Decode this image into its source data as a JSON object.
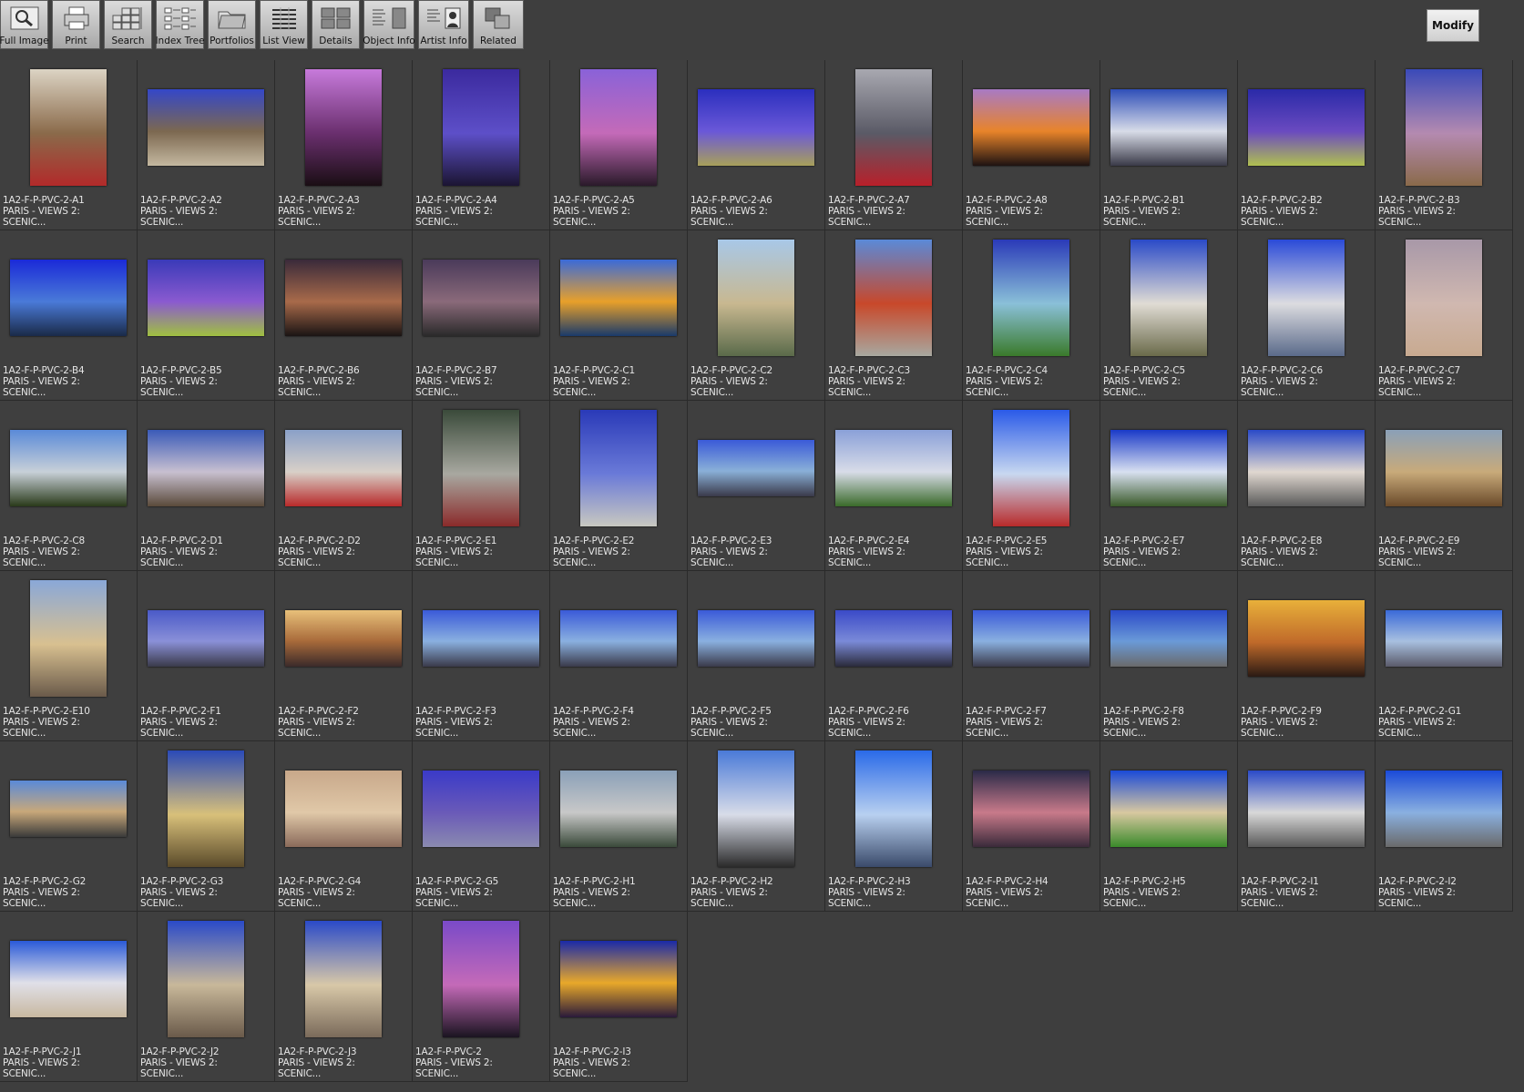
{
  "toolbar": {
    "buttons": [
      {
        "id": "full-image",
        "label": "Full Image",
        "icon": "magnifier-icon"
      },
      {
        "id": "print",
        "label": "Print",
        "icon": "printer-icon"
      },
      {
        "id": "search",
        "label": "Search",
        "icon": "search-icon"
      },
      {
        "id": "index-tree",
        "label": "Index Tree",
        "icon": "tree-icon"
      },
      {
        "id": "portfolios",
        "label": "Portfolios",
        "icon": "folder-icon"
      },
      {
        "id": "list-view",
        "label": "List View",
        "icon": "list-icon"
      },
      {
        "id": "details",
        "label": "Details",
        "icon": "details-icon"
      },
      {
        "id": "object-info",
        "label": "Object Info",
        "icon": "object-info-icon"
      },
      {
        "id": "artist-info",
        "label": "Artist  Info",
        "icon": "artist-info-icon"
      },
      {
        "id": "related",
        "label": "Related",
        "icon": "related-icon"
      }
    ],
    "modify_label": "Modify"
  },
  "caption_line2": "PARIS - VIEWS 2:",
  "caption_line3": "SCENIC...",
  "thumbnails": [
    {
      "code": "1A2-F-P-PVC-2-A1",
      "o": "p",
      "c": [
        "#dcd4c4",
        "#8a6a4a",
        "#b22a2a"
      ]
    },
    {
      "code": "1A2-F-P-PVC-2-A2",
      "o": "l",
      "c": [
        "#3447c8",
        "#7c6850",
        "#c4b8a0"
      ]
    },
    {
      "code": "1A2-F-P-PVC-2-A3",
      "o": "p",
      "c": [
        "#c77adb",
        "#6a2f6e",
        "#1a0e14"
      ]
    },
    {
      "code": "1A2-F-P-PVC-2-A4",
      "o": "p",
      "c": [
        "#3b2a9e",
        "#5d4fc8",
        "#1b1532"
      ]
    },
    {
      "code": "1A2-F-P-PVC-2-A5",
      "o": "p",
      "c": [
        "#8a62d8",
        "#c46ab8",
        "#2a1a2a"
      ]
    },
    {
      "code": "1A2-F-P-PVC-2-A6",
      "o": "l",
      "c": [
        "#2b2fbe",
        "#6a58d8",
        "#a8a05a"
      ]
    },
    {
      "code": "1A2-F-P-PVC-2-A7",
      "o": "p",
      "c": [
        "#a8a8b0",
        "#5a5a66",
        "#b8202a"
      ]
    },
    {
      "code": "1A2-F-P-PVC-2-A8",
      "o": "l",
      "c": [
        "#a87ac4",
        "#e8842a",
        "#1e1212"
      ]
    },
    {
      "code": "1A2-F-P-PVC-2-B1",
      "o": "l",
      "c": [
        "#2f4fb8",
        "#d8dce8",
        "#3a3a48"
      ]
    },
    {
      "code": "1A2-F-P-PVC-2-B2",
      "o": "l",
      "c": [
        "#2a2aa8",
        "#6a4ac0",
        "#b0c050"
      ]
    },
    {
      "code": "1A2-F-P-PVC-2-B3",
      "o": "p",
      "c": [
        "#3a4ab8",
        "#b48ab0",
        "#8a6a4a"
      ]
    },
    {
      "code": "1A2-F-P-PVC-2-B4",
      "o": "l",
      "c": [
        "#1a2ad8",
        "#4a7ad8",
        "#1a2a48"
      ]
    },
    {
      "code": "1A2-F-P-PVC-2-B5",
      "o": "l",
      "c": [
        "#3a3ab8",
        "#8a5ad0",
        "#a0c040"
      ]
    },
    {
      "code": "1A2-F-P-PVC-2-B6",
      "o": "l",
      "c": [
        "#3a2a3a",
        "#a86a4a",
        "#1a1414"
      ]
    },
    {
      "code": "1A2-F-P-PVC-2-B7",
      "o": "l",
      "c": [
        "#4a3a5a",
        "#8a6a7a",
        "#2a2a2a"
      ]
    },
    {
      "code": "1A2-F-P-PVC-2-C1",
      "o": "l",
      "c": [
        "#3a6ad8",
        "#e8a02a",
        "#1a3a6a"
      ]
    },
    {
      "code": "1A2-F-P-PVC-2-C2",
      "o": "p",
      "c": [
        "#a8c8e8",
        "#c8b890",
        "#5a6a4a"
      ]
    },
    {
      "code": "1A2-F-P-PVC-2-C3",
      "o": "p",
      "c": [
        "#5a8ad8",
        "#c8482a",
        "#a8a8a0"
      ]
    },
    {
      "code": "1A2-F-P-PVC-2-C4",
      "o": "p",
      "c": [
        "#2a3ab8",
        "#8ac0d8",
        "#3a7a2a"
      ]
    },
    {
      "code": "1A2-F-P-PVC-2-C5",
      "o": "p",
      "c": [
        "#2a4ac8",
        "#e0dcd4",
        "#6a6a4a"
      ]
    },
    {
      "code": "1A2-F-P-PVC-2-C6",
      "o": "p",
      "c": [
        "#2a4ad8",
        "#dcdce0",
        "#5a6a8a"
      ]
    },
    {
      "code": "1A2-F-P-PVC-2-C7",
      "o": "p",
      "c": [
        "#a898a8",
        "#d0b8b0",
        "#c8aa90"
      ]
    },
    {
      "code": "1A2-F-P-PVC-2-C8",
      "o": "l",
      "c": [
        "#5a8ad8",
        "#c8d0d8",
        "#2a3a1a"
      ]
    },
    {
      "code": "1A2-F-P-PVC-2-D1",
      "o": "l",
      "c": [
        "#3a5ab8",
        "#c8c0d0",
        "#5a4a3a"
      ]
    },
    {
      "code": "1A2-F-P-PVC-2-D2",
      "o": "l",
      "c": [
        "#8aa0c8",
        "#d8d0c8",
        "#b82a2a"
      ]
    },
    {
      "code": "1A2-F-P-PVC-2-E1",
      "o": "p",
      "c": [
        "#3a4a3a",
        "#a8a8a0",
        "#8a2a2a"
      ]
    },
    {
      "code": "1A2-F-P-PVC-2-E2",
      "o": "p",
      "c": [
        "#2a3ab8",
        "#6a7ad8",
        "#c8c8c0"
      ]
    },
    {
      "code": "1A2-F-P-PVC-2-E3",
      "o": "w",
      "c": [
        "#3a5ad8",
        "#8ab0d8",
        "#3a3a4a"
      ]
    },
    {
      "code": "1A2-F-P-PVC-2-E4",
      "o": "l",
      "c": [
        "#8aa0d8",
        "#d8dce8",
        "#3a6a2a"
      ]
    },
    {
      "code": "1A2-F-P-PVC-2-E5",
      "o": "p",
      "c": [
        "#2a5ae8",
        "#c8d8f0",
        "#b82a2a"
      ]
    },
    {
      "code": "1A2-F-P-PVC-2-E7",
      "o": "l",
      "c": [
        "#1a3ac8",
        "#d8e0f0",
        "#3a5a2a"
      ]
    },
    {
      "code": "1A2-F-P-PVC-2-E8",
      "o": "l",
      "c": [
        "#2a4ac8",
        "#e0d8d0",
        "#5a5a5a"
      ]
    },
    {
      "code": "1A2-F-P-PVC-2-E9",
      "o": "l",
      "c": [
        "#8aa0b8",
        "#c8aa7a",
        "#6a4a2a"
      ]
    },
    {
      "code": "1A2-F-P-PVC-2-E10",
      "o": "p",
      "c": [
        "#8aa8d8",
        "#d8c090",
        "#6a5a4a"
      ]
    },
    {
      "code": "1A2-F-P-PVC-2-F1",
      "o": "w",
      "c": [
        "#4a5ac8",
        "#8a90d8",
        "#3a3a4a"
      ]
    },
    {
      "code": "1A2-F-P-PVC-2-F2",
      "o": "w",
      "c": [
        "#e8c07a",
        "#a86a3a",
        "#3a2a2a"
      ]
    },
    {
      "code": "1A2-F-P-PVC-2-F3",
      "o": "w",
      "c": [
        "#3a5ad8",
        "#8ab0e0",
        "#3a3a4a"
      ]
    },
    {
      "code": "1A2-F-P-PVC-2-F4",
      "o": "w",
      "c": [
        "#3a5ad8",
        "#8ab0e0",
        "#3a3a4a"
      ]
    },
    {
      "code": "1A2-F-P-PVC-2-F5",
      "o": "w",
      "c": [
        "#3a5ad8",
        "#8ab0e0",
        "#3a3a4a"
      ]
    },
    {
      "code": "1A2-F-P-PVC-2-F6",
      "o": "w",
      "c": [
        "#3a4ac8",
        "#7a8ad8",
        "#2a2a3a"
      ]
    },
    {
      "code": "1A2-F-P-PVC-2-F7",
      "o": "w",
      "c": [
        "#3a5ad8",
        "#8ab0e0",
        "#3a3a4a"
      ]
    },
    {
      "code": "1A2-F-P-PVC-2-F8",
      "o": "w",
      "c": [
        "#2a4ac8",
        "#6a9ad8",
        "#6a6a6a"
      ]
    },
    {
      "code": "1A2-F-P-PVC-2-F9",
      "o": "l",
      "c": [
        "#e8b03a",
        "#c06a2a",
        "#2a1a14"
      ]
    },
    {
      "code": "1A2-F-P-PVC-2-G1",
      "o": "w",
      "c": [
        "#3a6ad8",
        "#a8c0e0",
        "#5a5a6a"
      ]
    },
    {
      "code": "1A2-F-P-PVC-2-G2",
      "o": "w",
      "c": [
        "#5a8ad8",
        "#c8a87a",
        "#3a3a3a"
      ]
    },
    {
      "code": "1A2-F-P-PVC-2-G3",
      "o": "p",
      "c": [
        "#2a4ab8",
        "#d8c07a",
        "#5a4a2a"
      ]
    },
    {
      "code": "1A2-F-P-PVC-2-G4",
      "o": "l",
      "c": [
        "#c8a88a",
        "#e0c8a8",
        "#8a6a5a"
      ]
    },
    {
      "code": "1A2-F-P-PVC-2-G5",
      "o": "l",
      "c": [
        "#3a3ac8",
        "#6a5ab8",
        "#8a8ab0"
      ]
    },
    {
      "code": "1A2-F-P-PVC-2-H1",
      "o": "l",
      "c": [
        "#8aa0b8",
        "#c8c8c8",
        "#3a4a3a"
      ]
    },
    {
      "code": "1A2-F-P-PVC-2-H2",
      "o": "p",
      "c": [
        "#4a7ad8",
        "#d8dce8",
        "#2a2a2a"
      ]
    },
    {
      "code": "1A2-F-P-PVC-2-H3",
      "o": "p",
      "c": [
        "#2a6ae8",
        "#b8d0f0",
        "#3a4a6a"
      ]
    },
    {
      "code": "1A2-F-P-PVC-2-H4",
      "o": "l",
      "c": [
        "#2a2a48",
        "#c87a8a",
        "#3a2a3a"
      ]
    },
    {
      "code": "1A2-F-P-PVC-2-H5",
      "o": "l",
      "c": [
        "#1a4ad8",
        "#d8c8a0",
        "#3a8a2a"
      ]
    },
    {
      "code": "1A2-F-P-PVC-2-I1",
      "o": "l",
      "c": [
        "#2a4ac8",
        "#d8d8d8",
        "#5a5a5a"
      ]
    },
    {
      "code": "1A2-F-P-PVC-2-I2",
      "o": "l",
      "c": [
        "#1a4ad8",
        "#8ab0e0",
        "#6a6a6a"
      ]
    },
    {
      "code": "1A2-F-P-PVC-2-J1",
      "o": "l",
      "c": [
        "#2a5ad8",
        "#e0e0e8",
        "#c8b8a0"
      ]
    },
    {
      "code": "1A2-F-P-PVC-2-J2",
      "o": "p",
      "c": [
        "#2a4ac8",
        "#c8b89a",
        "#6a5a4a"
      ]
    },
    {
      "code": "1A2-F-P-PVC-2-J3",
      "o": "p",
      "c": [
        "#2a4ac8",
        "#d8c8a8",
        "#7a6a5a"
      ]
    },
    {
      "code": "1A2-F-P-PVC-2",
      "o": "p",
      "c": [
        "#7a4ac8",
        "#c46ab8",
        "#1a1420"
      ]
    },
    {
      "code": "1A2-F-P-PVC-2-I3",
      "o": "l",
      "c": [
        "#1a2aa8",
        "#e8a82a",
        "#2a1a3a"
      ]
    }
  ]
}
